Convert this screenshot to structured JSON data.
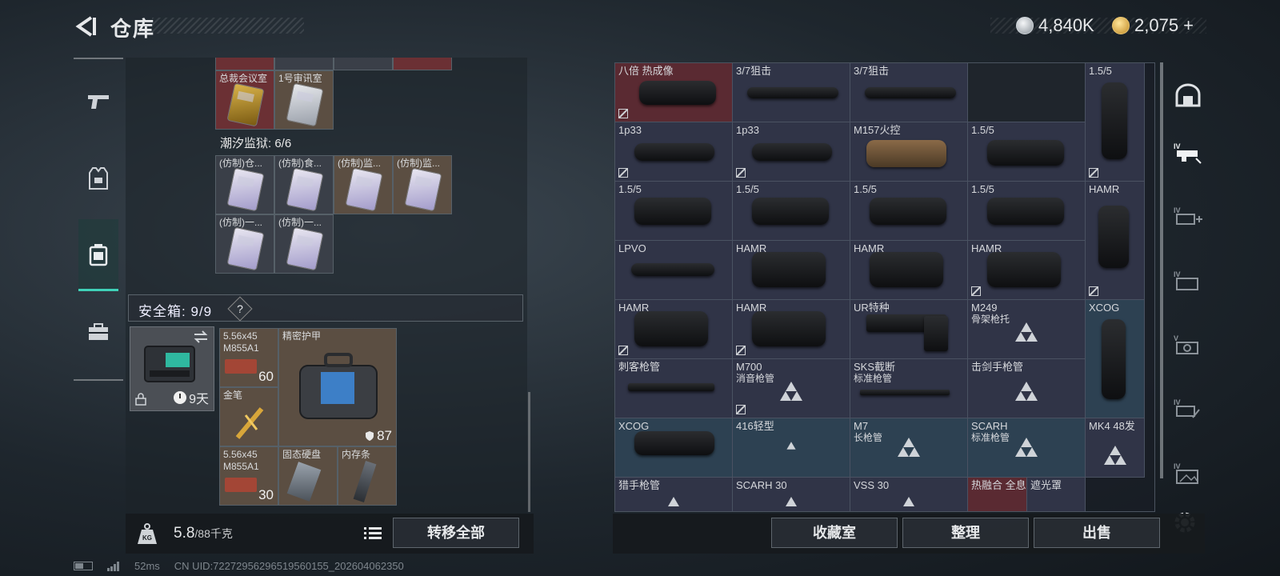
{
  "header": {
    "title": "仓库",
    "currency_silver": "4,840K",
    "currency_gold": "2,075",
    "currency_gold_plus": "+"
  },
  "left_nav": {
    "items": [
      {
        "name": "weapons",
        "icon": "pistol-icon"
      },
      {
        "name": "equipment",
        "icon": "vest-icon"
      },
      {
        "name": "storage",
        "icon": "case-icon",
        "active": true
      },
      {
        "name": "toolbox",
        "icon": "toolbox-icon"
      }
    ]
  },
  "storage": {
    "top_items": [
      {
        "label": "总裁会议室"
      },
      {
        "label": "1号审讯室"
      }
    ],
    "section_prison": "潮汐监狱: 6/6",
    "prison_items": [
      {
        "label": "(仿制)仓..."
      },
      {
        "label": "(仿制)食..."
      },
      {
        "label": "(仿制)监..."
      },
      {
        "label": "(仿制)监..."
      },
      {
        "label": "(仿制)一..."
      },
      {
        "label": "(仿制)一..."
      }
    ],
    "safe_title": "安全箱: 9/9",
    "safe_help": "?",
    "safebox_timer": "9天",
    "safe_items": [
      {
        "label": "5.56x45\nM855A1",
        "qty": "60"
      },
      {
        "label": "精密护甲",
        "qty": "87"
      },
      {
        "label": "金笔"
      },
      {
        "label": "5.56x45\nM855A1",
        "qty": "30"
      },
      {
        "label": "固态硬盘"
      },
      {
        "label": "内存条"
      }
    ]
  },
  "weight": {
    "icon_label": "KG",
    "current": "5.8",
    "max": "/88千克"
  },
  "transfer_all": "转移全部",
  "grid": {
    "cells": [
      {
        "label": "八倍 热成像"
      },
      {
        "label": "3/7狙击"
      },
      {
        "label": "3/7狙击"
      },
      {
        "label": "1.5/5"
      },
      {
        "label": "1p33"
      },
      {
        "label": "1p33"
      },
      {
        "label": "M157火控"
      },
      {
        "label": "1.5/5"
      },
      {
        "label": "1.5/5"
      },
      {
        "label": "1.5/5"
      },
      {
        "label": "1.5/5"
      },
      {
        "label": "1.5/5"
      },
      {
        "label": "HAMR"
      },
      {
        "label": "LPVO"
      },
      {
        "label": "HAMR"
      },
      {
        "label": "HAMR"
      },
      {
        "label": "HAMR"
      },
      {
        "label": "HAMR"
      },
      {
        "label": "HAMR"
      },
      {
        "label": "UR特种"
      },
      {
        "label": "M249",
        "sub": "骨架枪托"
      },
      {
        "label": "XCOG"
      },
      {
        "label": "刺客枪管"
      },
      {
        "label": "M700",
        "sub": "消音枪管"
      },
      {
        "label": "SKS截断",
        "sub": "标准枪管"
      },
      {
        "label": "击剑手枪管"
      },
      {
        "label": "XCOG"
      },
      {
        "label": "416轻型"
      },
      {
        "label": "M7",
        "sub": "长枪管"
      },
      {
        "label": "SCARH",
        "sub": "标准枪管"
      },
      {
        "label": "MK4 48发"
      },
      {
        "label": "猎手枪管"
      },
      {
        "label": "SCARH 30"
      },
      {
        "label": "VSS 30"
      },
      {
        "label": "热融合 全息"
      },
      {
        "label": "遮光罩"
      }
    ]
  },
  "bottom_buttons": {
    "collection": "收藏室",
    "sort": "整理",
    "sell": "出售"
  },
  "status": {
    "ping": "52ms",
    "uid": "CN UID:7227295629651956015​5_202604062350"
  }
}
